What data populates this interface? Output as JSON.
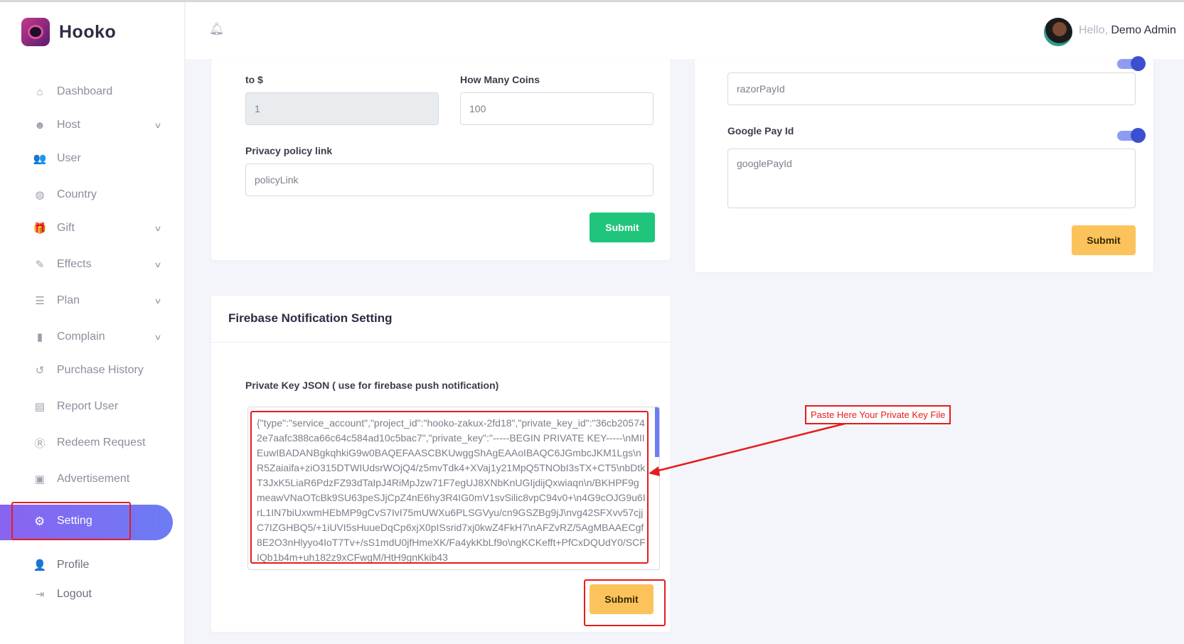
{
  "brand": {
    "name": "Hooko"
  },
  "sidebar": {
    "items": [
      {
        "label": "Dashboard",
        "icon": "home-icon",
        "glyph": "⌂",
        "chevron": false
      },
      {
        "label": "Host",
        "icon": "smiley-icon",
        "glyph": "☻",
        "chevron": true
      },
      {
        "label": "User",
        "icon": "users-icon",
        "glyph": "👥",
        "chevron": false
      },
      {
        "label": "Country",
        "icon": "globe-icon",
        "glyph": "◍",
        "chevron": false
      },
      {
        "label": "Gift",
        "icon": "gift-icon",
        "glyph": "🎁",
        "chevron": true
      },
      {
        "label": "Effects",
        "icon": "magic-wand-icon",
        "glyph": "✎",
        "chevron": true
      },
      {
        "label": "Plan",
        "icon": "list-icon",
        "glyph": "☰",
        "chevron": true
      },
      {
        "label": "Complain",
        "icon": "clipboard-icon",
        "glyph": "▮",
        "chevron": true
      },
      {
        "label": "Purchase History",
        "icon": "history-icon",
        "glyph": "↺",
        "chevron": false
      },
      {
        "label": "Report User",
        "icon": "id-card-icon",
        "glyph": "▤",
        "chevron": false
      },
      {
        "label": "Redeem Request",
        "icon": "registered-icon",
        "glyph": "Ⓡ",
        "chevron": false
      },
      {
        "label": "Advertisement",
        "icon": "ad-icon",
        "glyph": "▣",
        "chevron": false
      }
    ],
    "active": {
      "label": "Setting",
      "icon": "gear-icon",
      "glyph": "⚙"
    },
    "bottom": [
      {
        "label": "Profile",
        "icon": "user-icon",
        "glyph": "👤"
      },
      {
        "label": "Logout",
        "icon": "logout-icon",
        "glyph": "⇥"
      }
    ]
  },
  "header": {
    "bell_icon": "bell-icon",
    "greeting": "Hello,",
    "user_name": "Demo Admin"
  },
  "left_card": {
    "to_label": "to $",
    "to_value": "1",
    "coins_label": "How Many Coins",
    "coins_value": "100",
    "policy_label": "Privacy policy link",
    "policy_placeholder": "policyLink",
    "submit": "Submit"
  },
  "right_card": {
    "razor_placeholder": "razorPayId",
    "google_label": "Google Pay Id",
    "google_placeholder": "googlePayId",
    "submit": "Submit"
  },
  "firebase": {
    "title": "Firebase Notification Setting",
    "key_label": "Private Key JSON ( use for firebase push notification)",
    "key_value": "{\"type\":\"service_account\",\"project_id\":\"hooko-zakux-2fd18\",\"private_key_id\":\"36cb205742e7aafc388ca66c64c584ad10c5bac7\",\"private_key\":\"-----BEGIN PRIVATE KEY-----\\nMIIEuwIBADANBgkqhkiG9w0BAQEFAASCBKUwggShAgEAAoIBAQC6JGmbcJKM1Lgs\\nR5Zaiaifa+ziO315DTWIUdsrWOjQ4/z5mvTdk4+XVaj1y21MpQ5TNObI3sTX+CT5\\nbDtkT3JxK5LiaR6PdzFZ93dTaIpJ4RiMpJzw71F7egUJ8XNbKnUGIjdijQxwiaqn\\n/BKHPF9gmeawVNaOTcBk9SU63peSJjCpZ4nE6hy3R4IG0mV1svSilic8vpC94v0+\\n4G9cOJG9u6IrL1IN7biUxwmHEbMP9gCvS7IvI75mUWXu6PLSGVyu/cn9GSZBg9jJ\\nvg42SFXvv57cjjC7IZGHBQ5/+1iUVI5sHuueDqCp6xjX0pISsrid7xj0kwZ4FkH7\\nAFZvRZ/5AgMBAAECgf8E2O3nHlyyo4IoT7Tv+/sS1mdU0jfHmeXK/Fa4ykKbLf9o\\ngKCKefft+PfCxDQUdY0/SCFIQb1b4m+uh182z9xCFwgM/HtH9gnKkib43"
  },
  "callout": {
    "text": "Paste Here Your Private Key File"
  }
}
